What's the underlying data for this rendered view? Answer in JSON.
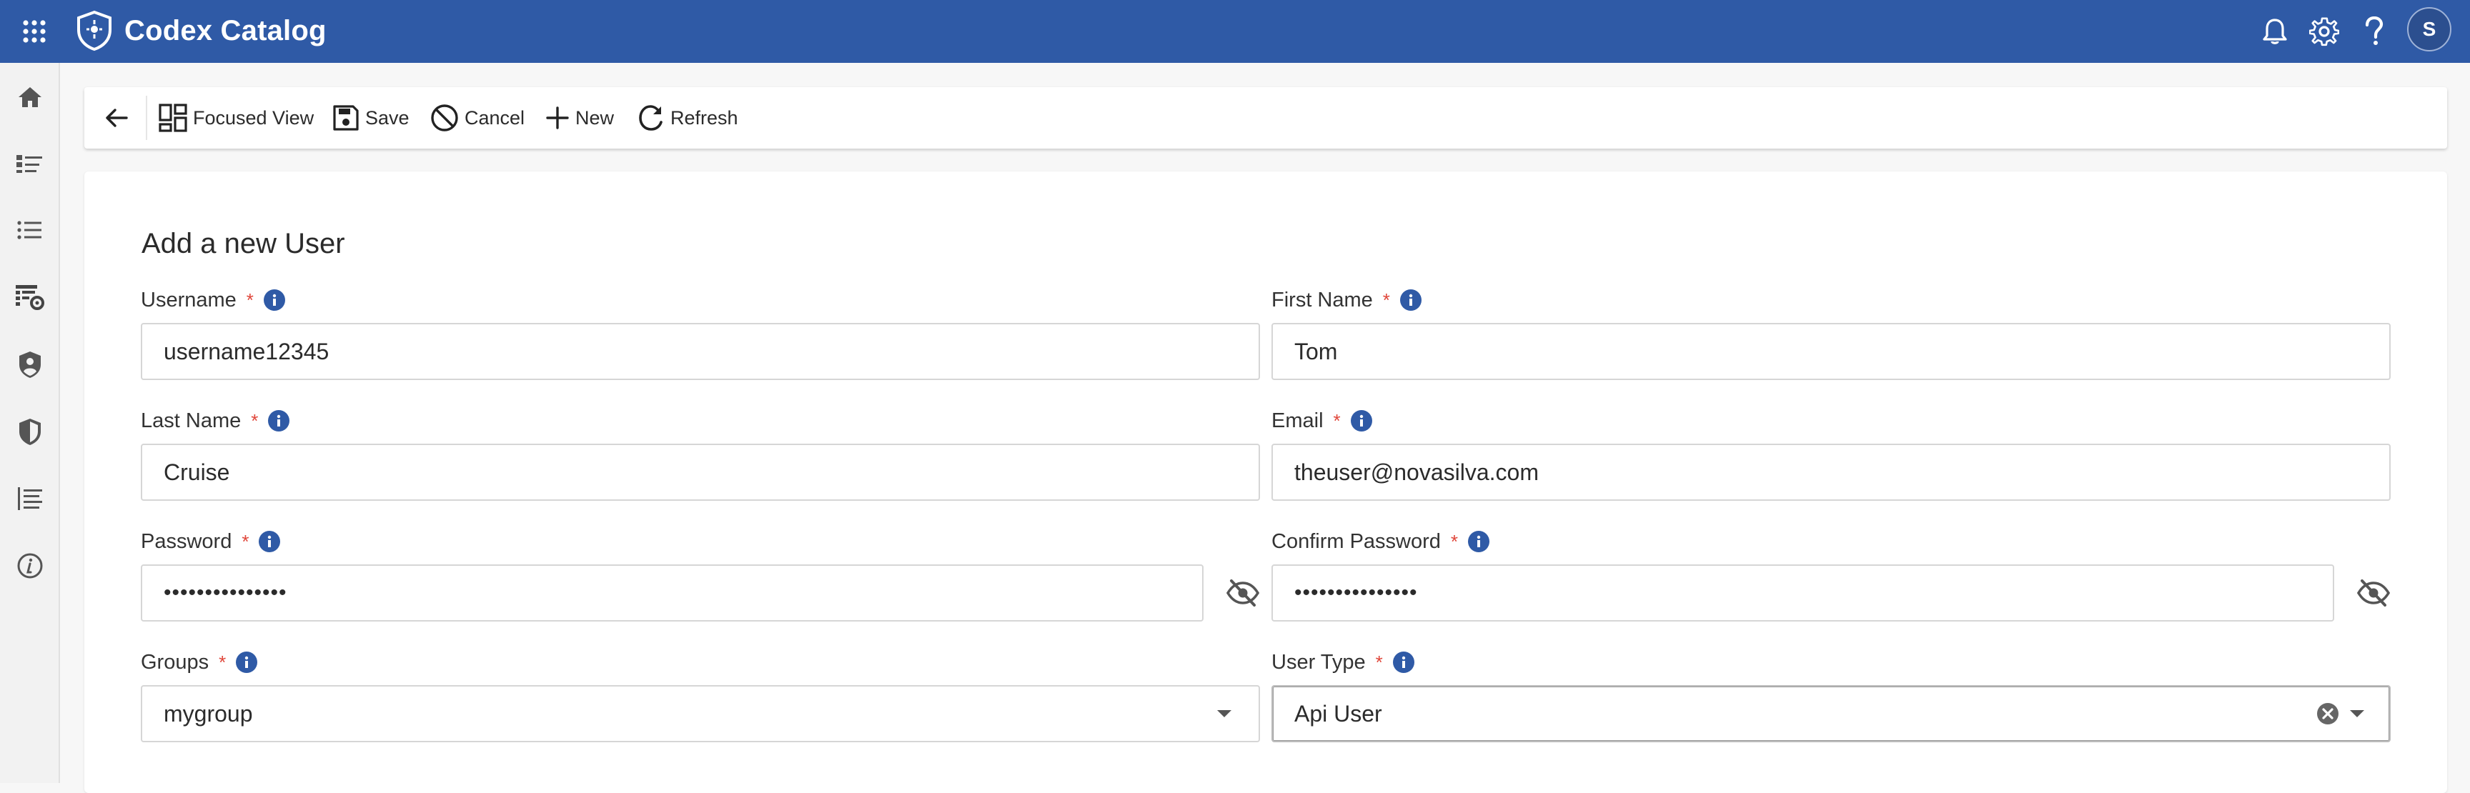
{
  "app": {
    "title": "Codex Catalog",
    "user_initial": "S"
  },
  "toolbar": {
    "focused_view": "Focused View",
    "save": "Save",
    "cancel": "Cancel",
    "new": "New",
    "refresh": "Refresh"
  },
  "form": {
    "title": "Add a new User",
    "required_mark": "*",
    "username": {
      "label": "Username",
      "value": "username12345"
    },
    "first_name": {
      "label": "First Name",
      "value": "Tom"
    },
    "last_name": {
      "label": "Last Name",
      "value": "Cruise"
    },
    "email": {
      "label": "Email",
      "value": "theuser@novasilva.com"
    },
    "password": {
      "label": "Password",
      "value": "•••••••••••••••"
    },
    "confirm_password": {
      "label": "Confirm Password",
      "value": "•••••••••••••••"
    },
    "groups": {
      "label": "Groups",
      "value": "mygroup"
    },
    "user_type": {
      "label": "User Type",
      "value": "Api User"
    }
  },
  "icons": {
    "rail": [
      "home-icon",
      "catalog-list-icon",
      "list-icon",
      "catalog-settings-icon",
      "user-shield-icon",
      "shield-icon",
      "tree-list-icon",
      "info-icon"
    ],
    "top": [
      "apps-grid-icon",
      "notifications-bell-icon",
      "settings-gear-icon",
      "help-icon"
    ]
  },
  "colors": {
    "brand": "#2f5aa6",
    "required": "#e0463a"
  }
}
